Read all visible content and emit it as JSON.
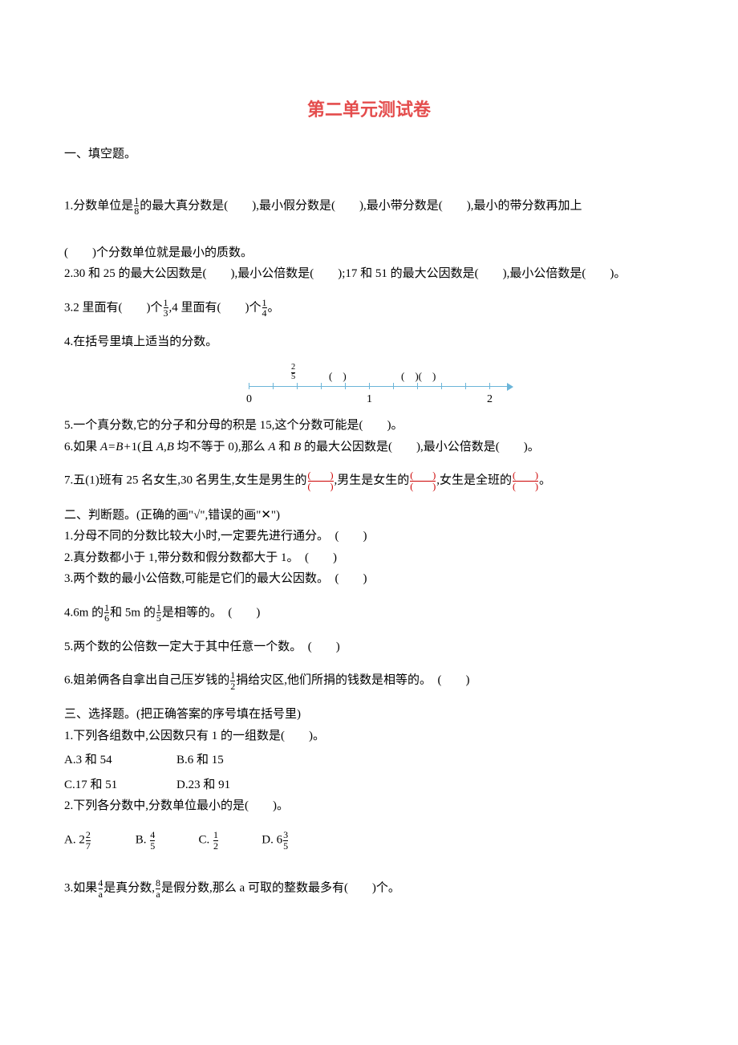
{
  "title": "第二单元测试卷",
  "s1": {
    "head": "一、填空题。",
    "q1a": "1.分数单位是",
    "q1_frac_n": "1",
    "q1_frac_d": "8",
    "q1b": "的最大真分数是(　　),最小假分数是(　　),最小带分数是(　　),最小的带分数再加上",
    "q1c": "(　　)个分数单位就是最小的质数。",
    "q2": "2.30 和 25 的最大公因数是(　　),最小公倍数是(　　);17 和 51 的最大公因数是(　　),最小公倍数是(　　)。",
    "q3a": "3.2 里面有(　　)个",
    "q3_f1_n": "1",
    "q3_f1_d": "3",
    "q3b": ",4 里面有(　　)个",
    "q3_f2_n": "1",
    "q3_f2_d": "4",
    "q3c": "。",
    "q4": "4.在括号里填上适当的分数。",
    "nl": {
      "t1_n": "2",
      "t1_d": "5",
      "t2": "(　)",
      "t3": "(　)(　)",
      "b0": "0",
      "b1": "1",
      "b2": "2"
    },
    "q5": "5.一个真分数,它的分子和分母的积是 15,这个分数可能是(　　)。",
    "q6a": "6.如果 ",
    "q6_eq": "A=B+",
    "q6b": "1(且 ",
    "q6_AB": "A,B",
    "q6c": " 均不等于 0),那么 ",
    "q6_A": "A",
    "q6d": " 和 ",
    "q6_B": "B",
    "q6e": " 的最大公因数是(　　),最小公倍数是(　　)。",
    "q7a": "7.五(1)班有 25 名女生,30 名男生,女生是男生的",
    "q7b": ",男生是女生的",
    "q7c": ",女生是全班的",
    "q7d": "。",
    "q7_fn": "(　　)",
    "q7_fd": "(　　)"
  },
  "s2": {
    "head": "二、判断题。(正确的画\"√\",错误的画\"✕\")",
    "q1": "1.分母不同的分数比较大小时,一定要先进行通分。　(　　)",
    "q2": "2.真分数都小于 1,带分数和假分数都大于 1。　(　　)",
    "q3": "3.两个数的最小公倍数,可能是它们的最大公因数。　(　　)",
    "q4a": "4.6m 的",
    "q4_f1_n": "1",
    "q4_f1_d": "6",
    "q4b": "和 5m 的",
    "q4_f2_n": "1",
    "q4_f2_d": "5",
    "q4c": "是相等的。　(　　)",
    "q5": "5.两个数的公倍数一定大于其中任意一个数。　(　　)",
    "q6a": "6.姐弟俩各自拿出自己压岁钱的",
    "q6_f_n": "1",
    "q6_f_d": "2",
    "q6b": "捐给灾区,他们所捐的钱数是相等的。　(　　)"
  },
  "s3": {
    "head": "三、选择题。(把正确答案的序号填在括号里)",
    "q1": "1.下列各组数中,公因数只有 1 的一组数是(　　)。",
    "q1a": "A.3 和 54",
    "q1b": "B.6 和 15",
    "q1c": "C.17 和 51",
    "q1d": "D.23 和 91",
    "q2": "2.下列各分数中,分数单位最小的是(　　)。",
    "q2a_pre": "A. 2",
    "q2a_n": "2",
    "q2a_d": "7",
    "q2b_pre": "B. ",
    "q2b_n": "4",
    "q2b_d": "5",
    "q2c_pre": "C. ",
    "q2c_n": "1",
    "q2c_d": "2",
    "q2d_pre": "D. 6",
    "q2d_n": "3",
    "q2d_d": "5",
    "q3a": "3.如果",
    "q3_f1_n": "4",
    "q3_f1_d": "a",
    "q3b": "是真分数,",
    "q3_f2_n": "8",
    "q3_f2_d": "a",
    "q3c": "是假分数,那么 a 可取的整数最多有(　　)个。"
  }
}
